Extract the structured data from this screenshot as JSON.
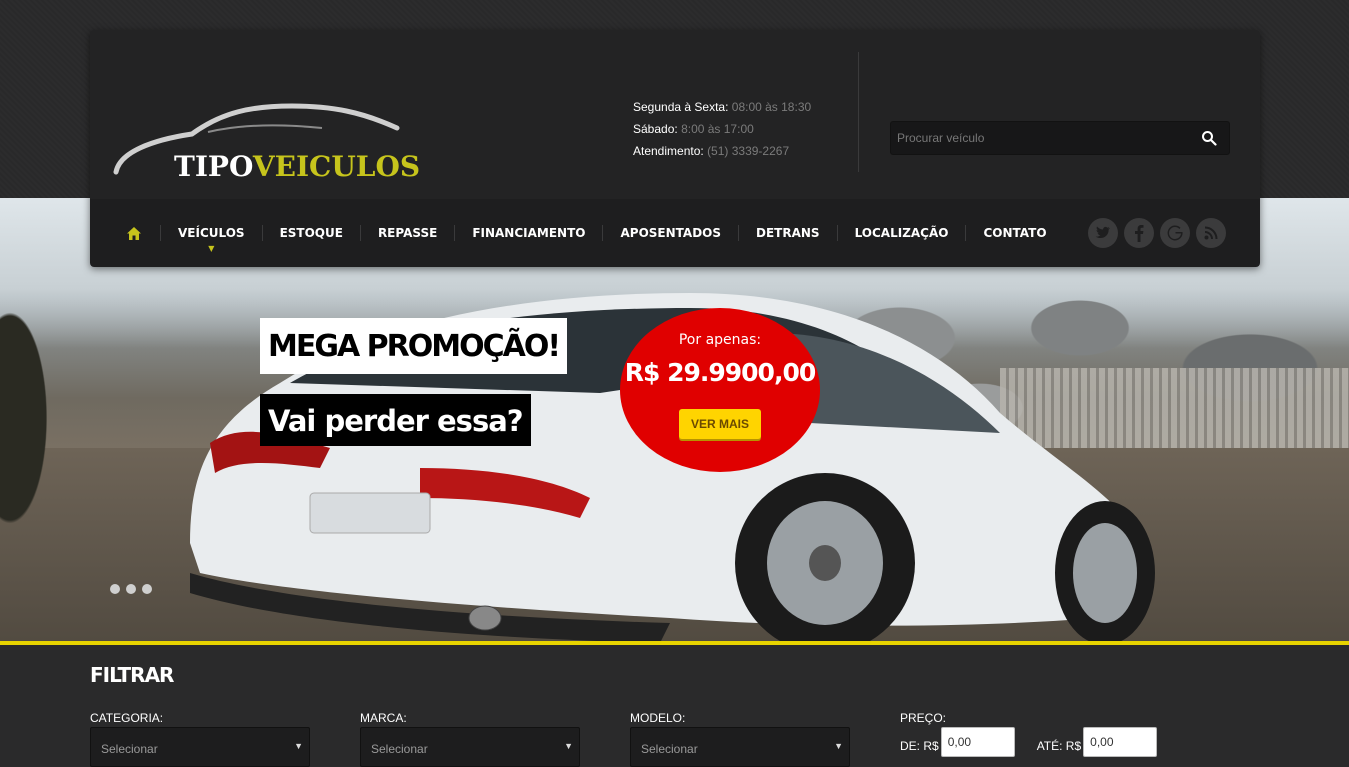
{
  "brand": {
    "logo_part1": "TIPO",
    "logo_part2": "VEICULOS"
  },
  "hours": [
    {
      "label": "Segunda à Sexta:",
      "value": "08:00 às 18:30"
    },
    {
      "label": "Sábado:",
      "value": "8:00 às 17:00"
    },
    {
      "label": "Atendimento:",
      "value": "(51) 3339-2267"
    }
  ],
  "search": {
    "placeholder": "Procurar veículo"
  },
  "nav": {
    "items": [
      "VEÍCULOS",
      "ESTOQUE",
      "REPASSE",
      "FINANCIAMENTO",
      "APOSENTADOS",
      "DETRANS",
      "LOCALIZAÇÃO",
      "CONTATO"
    ],
    "social": [
      "twitter-icon",
      "facebook-icon",
      "google-plus-icon",
      "rss-icon"
    ]
  },
  "hero": {
    "title": "MEGA PROMOÇÃO!",
    "subtitle": "Vai perder essa?",
    "price_label": "Por apenas:",
    "price_value": "R$ 29.9900,00",
    "cta": "VER MAIS",
    "slides": 3
  },
  "filter": {
    "title": "FILTRAR",
    "categoria_label": "CATEGORIA:",
    "categoria_value": "Selecionar",
    "marca_label": "MARCA:",
    "marca_value": "Selecionar",
    "modelo_label": "MODELO:",
    "modelo_value": "Selecionar",
    "preco_label": "PREÇO:",
    "de_label": "DE: R$",
    "de_value": "0,00",
    "ate_label": "ATÉ: R$",
    "ate_value": "0,00"
  },
  "colors": {
    "accent": "#c6c41c",
    "promo_red": "#e00000",
    "cta_yellow": "#ffd400"
  }
}
